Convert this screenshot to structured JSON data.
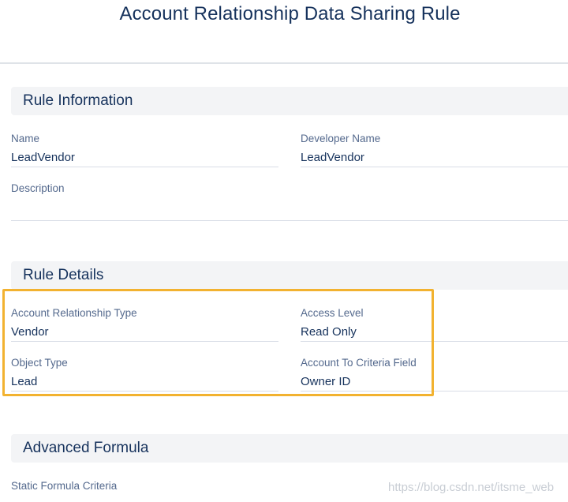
{
  "page": {
    "title": "Account Relationship Data Sharing Rule"
  },
  "rule_information": {
    "heading": "Rule Information",
    "name": {
      "label": "Name",
      "value": "LeadVendor"
    },
    "developer_name": {
      "label": "Developer Name",
      "value": "LeadVendor"
    },
    "description": {
      "label": "Description",
      "value": ""
    }
  },
  "rule_details": {
    "heading": "Rule Details",
    "account_relationship_type": {
      "label": "Account Relationship Type",
      "value": "Vendor"
    },
    "access_level": {
      "label": "Access Level",
      "value": "Read Only"
    },
    "object_type": {
      "label": "Object Type",
      "value": "Lead"
    },
    "account_to_criteria_field": {
      "label": "Account To Criteria Field",
      "value": "Owner ID"
    }
  },
  "advanced_formula": {
    "heading": "Advanced Formula",
    "static_formula_criteria": {
      "label": "Static Formula Criteria",
      "value": ""
    }
  },
  "watermark": "https://blog.csdn.net/itsme_web",
  "colors": {
    "heading_text": "#16325c",
    "label_text": "#54698d",
    "section_bg": "#f3f4f6",
    "highlight_border": "#f2b230"
  }
}
